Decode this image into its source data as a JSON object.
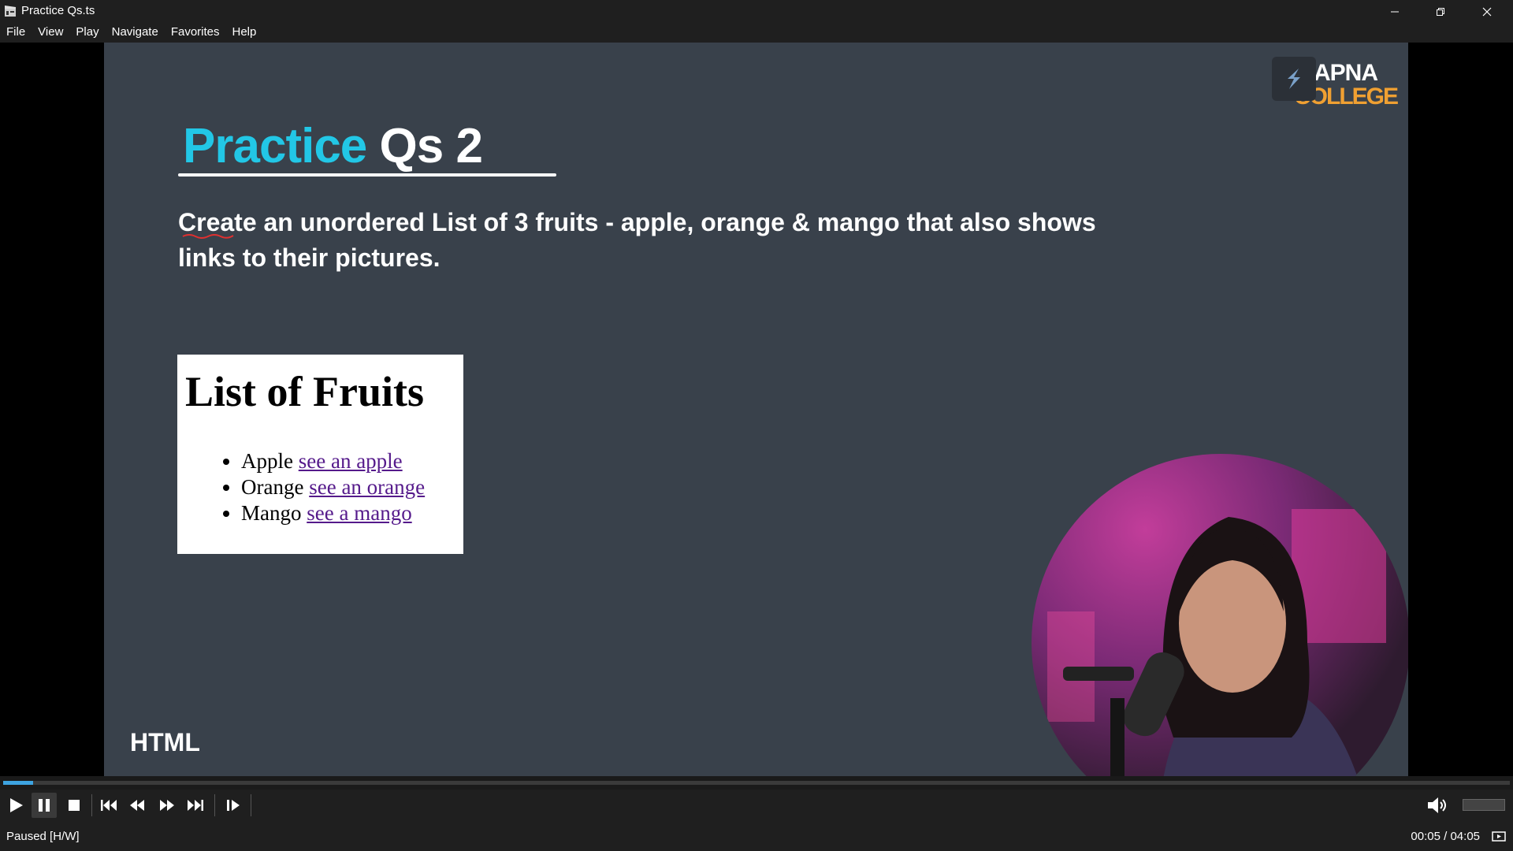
{
  "window": {
    "title": "Practice Qs.ts"
  },
  "menu": [
    "File",
    "View",
    "Play",
    "Navigate",
    "Favorites",
    "Help"
  ],
  "slide": {
    "title_accent": "Practice",
    "title_rest": "Qs 2",
    "question": "Create an unordered List of 3 fruits - apple, orange & mango that also shows links to their pictures.",
    "logo_top": "APNA",
    "logo_bottom": "COLLEGE",
    "tag": "HTML",
    "preview": {
      "heading": "List of Fruits",
      "items": [
        {
          "name": "Apple",
          "link": "see an apple"
        },
        {
          "name": "Orange",
          "link": "see an orange"
        },
        {
          "name": "Mango",
          "link": "see a mango"
        }
      ]
    }
  },
  "playback": {
    "status": "Paused [H/W]",
    "time": "00:05 / 04:05",
    "progress": 0.02,
    "volume": 0.0
  },
  "colors": {
    "accent": "#22c7e6",
    "logo_orange": "#f0a032",
    "slide_bg": "#39414b",
    "seek": "#3da3e0"
  }
}
